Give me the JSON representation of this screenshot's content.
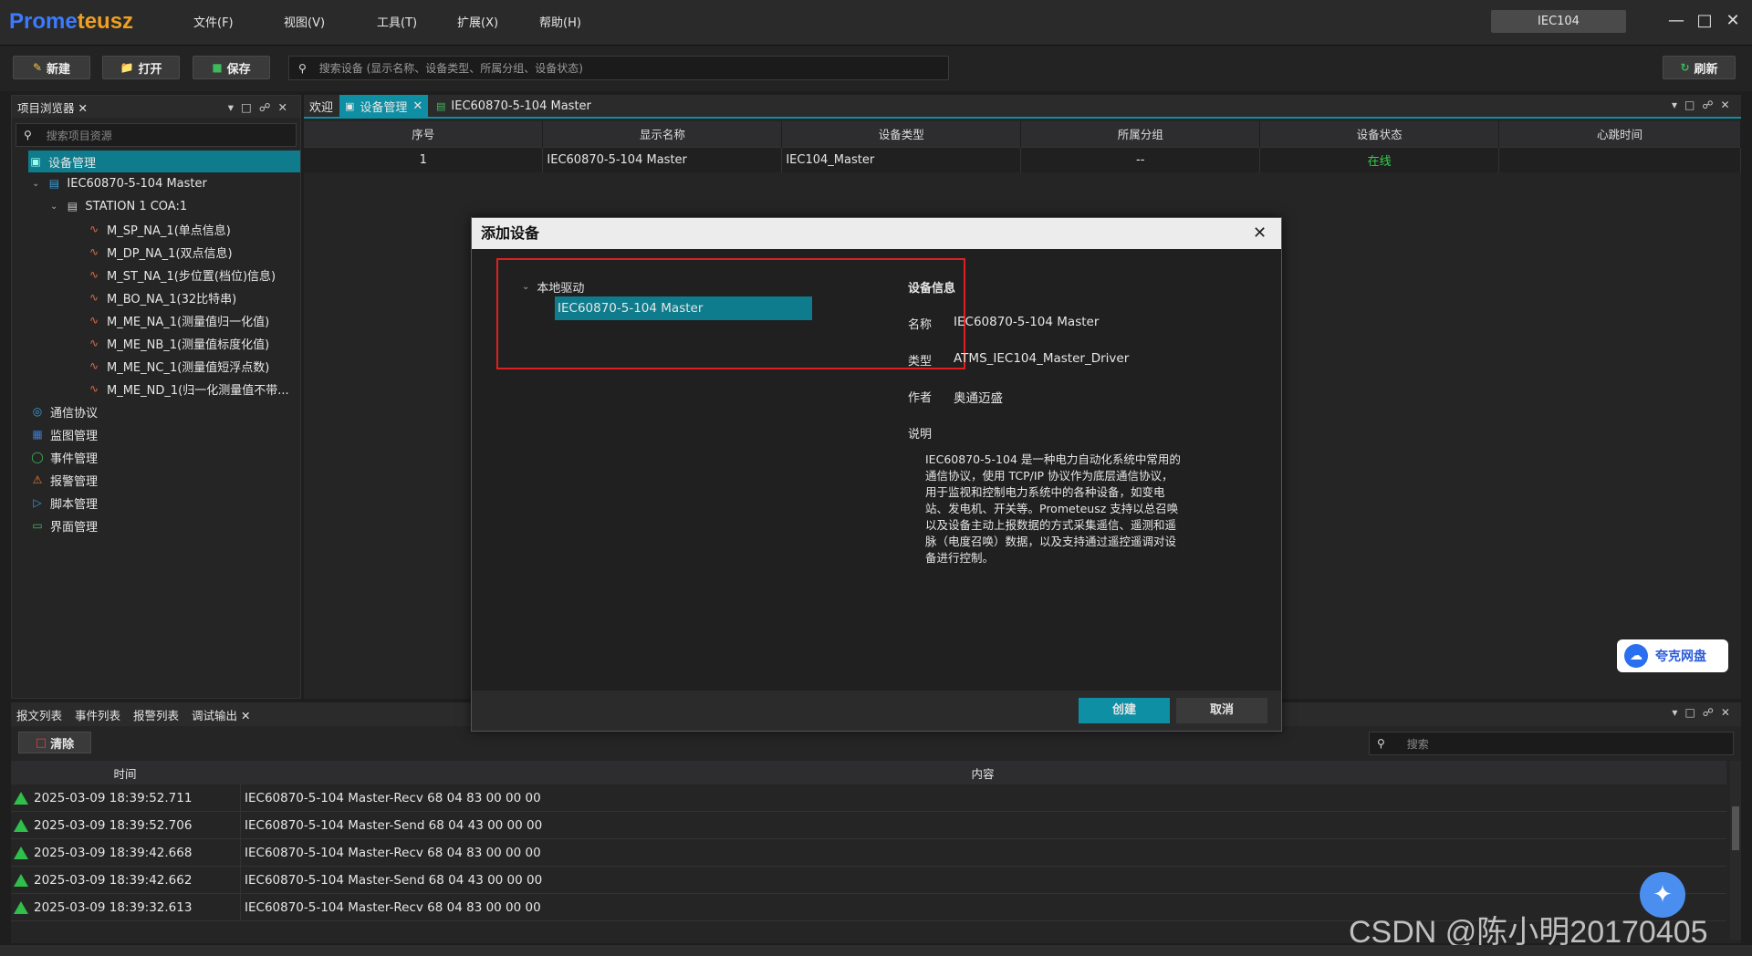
{
  "app": {
    "logo_part1": "Prome",
    "logo_part2": "teusz",
    "title_pill": "IEC104"
  },
  "menu": [
    "文件(F)",
    "视图(V)",
    "工具(T)",
    "扩展(X)",
    "帮助(H)"
  ],
  "toolbar": {
    "new_label": "新建",
    "open_label": "打开",
    "save_label": "保存",
    "search_placeholder": "搜索设备 (显示名称、设备类型、所属分组、设备状态)",
    "refresh_label": "刷新"
  },
  "project_browser": {
    "title": "项目浏览器",
    "search_placeholder": "搜索项目资源",
    "device_mgmt": "设备管理",
    "master": "IEC60870-5-104 Master",
    "station": "STATION 1  COA:1",
    "points": [
      "M_SP_NA_1(单点信息)",
      "M_DP_NA_1(双点信息)",
      "M_ST_NA_1(步位置(档位)信息)",
      "M_BO_NA_1(32比特串)",
      "M_ME_NA_1(测量值归一化值)",
      "M_ME_NB_1(测量值标度化值)",
      "M_ME_NC_1(测量值短浮点数)",
      "M_ME_ND_1(归一化测量值不带..."
    ],
    "sections": [
      "通信协议",
      "监图管理",
      "事件管理",
      "报警管理",
      "脚本管理",
      "界面管理"
    ]
  },
  "tabs": [
    "欢迎",
    "设备管理",
    "IEC60870-5-104 Master"
  ],
  "device_table": {
    "headers": [
      "序号",
      "显示名称",
      "设备类型",
      "所属分组",
      "设备状态",
      "心跳时间"
    ],
    "row": [
      "1",
      "IEC60870-5-104 Master",
      "IEC104_Master",
      "--",
      "在线",
      ""
    ]
  },
  "modal": {
    "title": "添加设备",
    "tree_root": "本地驱动",
    "tree_item": "IEC60870-5-104 Master",
    "info_title": "设备信息",
    "name_label": "名称",
    "name_value": "IEC60870-5-104 Master",
    "type_label": "类型",
    "type_value": "ATMS_IEC104_Master_Driver",
    "author_label": "作者",
    "author_value": "奥通迈盛",
    "desc_label": "说明",
    "desc_lines": [
      "IEC60870-5-104 是一种电力自动化系统中常用的",
      "通信协议，使用 TCP/IP 协议作为底层通信协议，",
      "用于监视和控制电力系统中的各种设备，如变电",
      "站、发电机、开关等。Prometeusz 支持以总召唤",
      "以及设备主动上报数据的方式采集遥信、遥测和遥",
      "脉（电度召唤）数据，以及支持通过遥控遥调对设",
      "备进行控制。"
    ],
    "create_label": "创建",
    "cancel_label": "取消"
  },
  "bottom": {
    "tabs": [
      "报文列表",
      "事件列表",
      "报警列表",
      "调试输出"
    ],
    "clear_label": "清除",
    "search_placeholder": "搜索",
    "col_time": "时间",
    "col_content": "内容",
    "rows": [
      {
        "time": "2025-03-09 18:39:52.711",
        "content": "IEC60870-5-104 Master-Recv 68 04 83 00 00 00"
      },
      {
        "time": "2025-03-09 18:39:52.706",
        "content": "IEC60870-5-104 Master-Send 68 04 43 00 00 00"
      },
      {
        "time": "2025-03-09 18:39:42.668",
        "content": "IEC60870-5-104 Master-Recv 68 04 83 00 00 00"
      },
      {
        "time": "2025-03-09 18:39:42.662",
        "content": "IEC60870-5-104 Master-Send 68 04 43 00 00 00"
      },
      {
        "time": "2025-03-09 18:39:32.613",
        "content": "IEC60870-5-104 Master-Recv 68 04 83 00 00 00"
      }
    ]
  },
  "overlay": {
    "cloud_label": "夸克网盘",
    "watermark": "CSDN @陈小明20170405"
  },
  "colors": {
    "accent": "#0e7c8c",
    "online": "#2fd24a",
    "highlight_box": "#e02020"
  }
}
